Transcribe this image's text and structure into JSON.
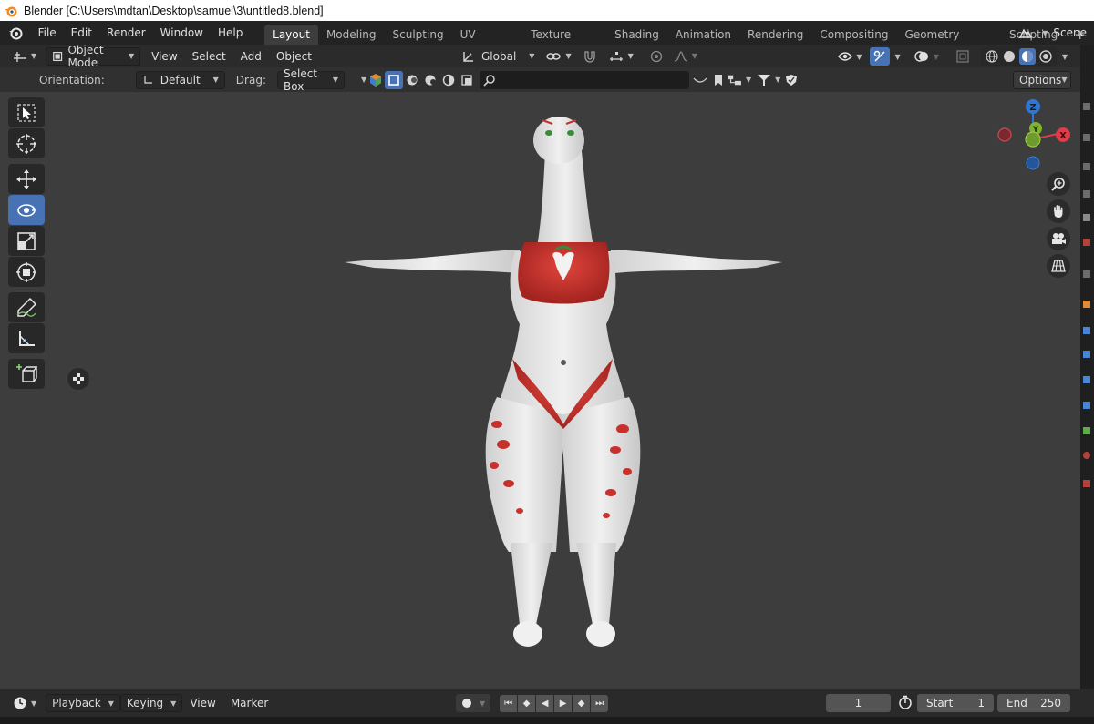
{
  "window": {
    "title": "Blender [C:\\Users\\mdtan\\Desktop\\samuel\\3\\untitled8.blend]"
  },
  "menubar": {
    "menus": [
      "File",
      "Edit",
      "Render",
      "Window",
      "Help"
    ],
    "workspaces": [
      "Layout",
      "Modeling",
      "Sculpting",
      "UV Editing",
      "Texture Paint",
      "Shading",
      "Animation",
      "Rendering",
      "Compositing",
      "Geometry Nodes",
      "Scripting"
    ],
    "active_workspace": "Layout",
    "add_tab": "+",
    "scene": "Scene"
  },
  "viewport_header": {
    "mode": "Object Mode",
    "menus": [
      "View",
      "Select",
      "Add",
      "Object"
    ],
    "transform_orientation": "Global"
  },
  "tool_settings": {
    "orientation_label": "Orientation:",
    "orientation_value": "Default",
    "drag_label": "Drag:",
    "drag_value": "Select Box",
    "options_label": "Options"
  },
  "gizmo": {
    "x_label": "X",
    "y_label": "Y",
    "z_label": "Z"
  },
  "timeline": {
    "menus": [
      "Playback",
      "Keying",
      "View",
      "Marker"
    ],
    "current_frame": "1",
    "start_label": "Start",
    "start_value": "1",
    "end_label": "End",
    "end_value": "250"
  },
  "colors": {
    "accent": "#4772b3",
    "axis_x": "#e03b48",
    "axis_y": "#7fb52a",
    "axis_z": "#2f77d6",
    "outfit_red": "#c8312b"
  }
}
